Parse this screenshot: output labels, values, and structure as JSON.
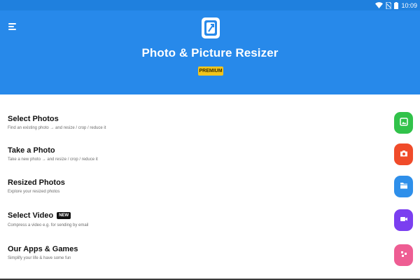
{
  "status_bar": {
    "time": "10:09",
    "icons": [
      "wifi-icon",
      "no-sim-icon",
      "battery-icon"
    ]
  },
  "header": {
    "menu_icon": "hamburger-menu-icon",
    "logo_icon": "resize-photo-icon",
    "title": "Photo & Picture Resizer",
    "badge": "PREMIUM"
  },
  "colors": {
    "header_bg": "#2789ea",
    "status_bg": "#1f80de",
    "premium_badge": "#f2c41b",
    "green": "#31c24a",
    "red": "#f04b2a",
    "blue": "#2e8fea",
    "purple": "#7b3ff0",
    "pink": "#ee5d93"
  },
  "menu": {
    "items": [
      {
        "title": "Select Photos",
        "subtitle": "Find an existing photo → and resize / crop / reduce it",
        "icon": "gallery-icon"
      },
      {
        "title": "Take a Photo",
        "subtitle": "Take a new photo → and resize / crop / reduce it",
        "icon": "camera-icon"
      },
      {
        "title": "Resized Photos",
        "subtitle": "Explore your resized photos",
        "icon": "folder-icon"
      },
      {
        "title": "Select Video",
        "badge": "NEW",
        "subtitle": "Compress a video e.g. for sending by email",
        "icon": "video-camera-icon"
      },
      {
        "title": "Our Apps & Games",
        "subtitle": "Simplify your life & have some fun",
        "icon": "apps-icon"
      }
    ]
  }
}
